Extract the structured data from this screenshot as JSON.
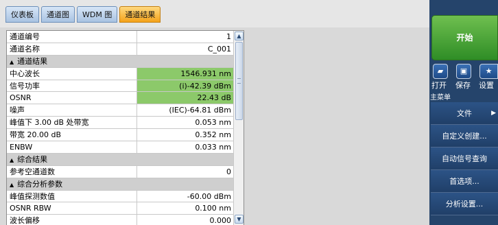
{
  "tabs": [
    "仪表板",
    "通道图",
    "WDM 图",
    "通道结果"
  ],
  "rows": [
    {
      "label": "通道编号",
      "value": "1",
      "type": "data",
      "hl": false
    },
    {
      "label": "通道名称",
      "value": "C_001",
      "type": "data",
      "hl": false
    },
    {
      "label": "通道结果",
      "value": "",
      "type": "section",
      "hl": false
    },
    {
      "label": "中心波长",
      "value": "1546.931 nm",
      "type": "data",
      "hl": true
    },
    {
      "label": "信号功率",
      "value": "(i)-42.39 dBm",
      "type": "data",
      "hl": true
    },
    {
      "label": "OSNR",
      "value": "22.43 dB",
      "type": "data",
      "hl": true
    },
    {
      "label": "噪声",
      "value": "(IEC)-64.81 dBm",
      "type": "data",
      "hl": false
    },
    {
      "label": "峰值下 3.00 dB 处带宽",
      "value": "0.053 nm",
      "type": "data",
      "hl": false
    },
    {
      "label": "带宽 20.00 dB",
      "value": "0.352 nm",
      "type": "data",
      "hl": false
    },
    {
      "label": "ENBW",
      "value": "0.033 nm",
      "type": "data",
      "hl": false
    },
    {
      "label": "综合结果",
      "value": "",
      "type": "section",
      "hl": false
    },
    {
      "label": "参考空通道数",
      "value": "0",
      "type": "data",
      "hl": false
    },
    {
      "label": "综合分析参数",
      "value": "",
      "type": "section",
      "hl": false
    },
    {
      "label": "峰值探测数值",
      "value": "-60.00 dBm",
      "type": "data",
      "hl": false
    },
    {
      "label": "OSNR RBW",
      "value": "0.100 nm",
      "type": "data",
      "hl": false
    },
    {
      "label": "波长偏移",
      "value": "0.000",
      "type": "data",
      "hl": false
    }
  ],
  "start_label": "开始",
  "icons": [
    {
      "label": "打开",
      "icon": "folder-open-icon",
      "glyph": "▰"
    },
    {
      "label": "保存",
      "icon": "floppy-save-icon",
      "glyph": "▣"
    },
    {
      "label": "设置",
      "icon": "star-icon",
      "glyph": "★"
    }
  ],
  "menu_header": "主菜单",
  "menu": [
    {
      "label": "文件",
      "arrow": "▶"
    },
    {
      "label": "自定义创建...",
      "arrow": ""
    },
    {
      "label": "自动信号查询",
      "arrow": ""
    },
    {
      "label": "首选项...",
      "arrow": ""
    },
    {
      "label": "分析设置...",
      "arrow": ""
    }
  ],
  "section_arrow": "▲",
  "scroll_up": "▲",
  "scroll_down": "▼",
  "colors": {
    "highlight": "#8cc96a",
    "active_tab": "#f4a21a",
    "side_panel": "#25446b",
    "start_button": "#3c9a2f"
  }
}
